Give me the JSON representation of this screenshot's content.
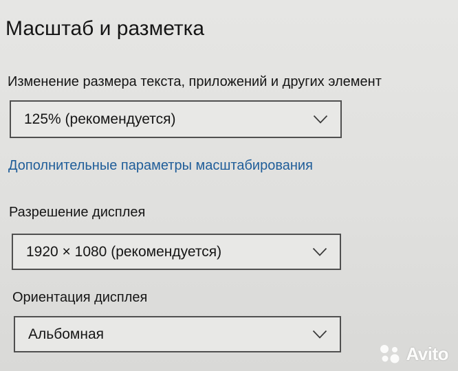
{
  "section": {
    "title": "Масштаб и разметка"
  },
  "scale": {
    "label": "Изменение размера текста, приложений и других элемент",
    "value": "125% (рекомендуется)"
  },
  "advanced_link": {
    "label": "Дополнительные параметры масштабирования"
  },
  "resolution": {
    "label": "Разрешение дисплея",
    "value": "1920 × 1080 (рекомендуется)"
  },
  "orientation": {
    "label": "Ориентация дисплея",
    "value": "Альбомная"
  },
  "watermark": {
    "text": "Avito"
  },
  "colors": {
    "background": "#e3e3e1",
    "text": "#151515",
    "link": "#1f5d99",
    "dropdown_border": "#4f4f4f"
  },
  "icons": {
    "dropdown_chevron": "chevron-down-icon",
    "watermark_logo": "avito-logo-icon"
  }
}
